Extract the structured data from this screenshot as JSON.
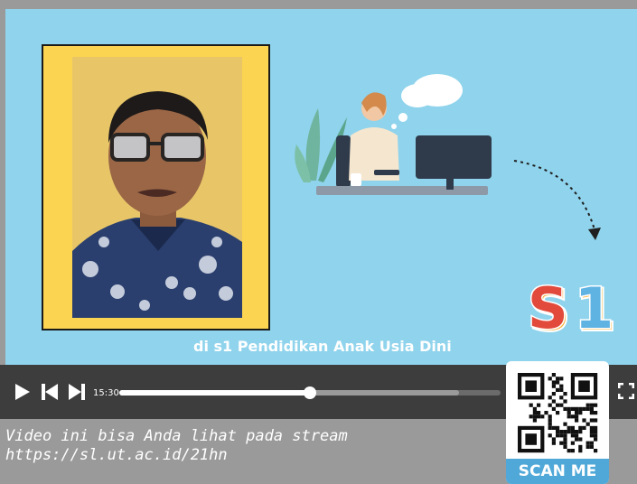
{
  "video": {
    "caption": "di s1 Pendidikan Anak Usia Dini",
    "logo_text": "S1",
    "colors": {
      "background": "#8fd3ec",
      "frame": "#fbd451",
      "controls": "#3d3d3d"
    }
  },
  "player": {
    "time": "15:30",
    "progress": 0.5,
    "buffered": 0.89,
    "icons": [
      "play-icon",
      "previous-icon",
      "next-icon",
      "fullscreen-icon"
    ]
  },
  "footer": {
    "line1": "Video ini bisa Anda lihat pada stream",
    "line2": "https://sl.ut.ac.id/21hn"
  },
  "qr": {
    "label": "SCAN ME",
    "accent": "#4fa8d8"
  }
}
